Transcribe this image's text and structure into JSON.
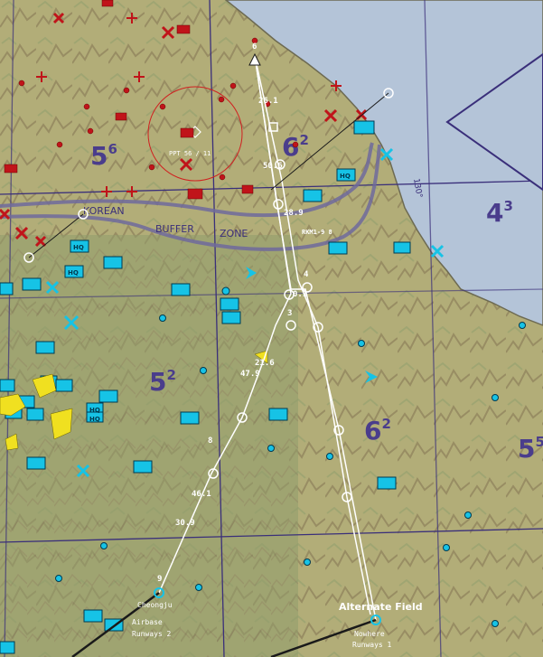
{
  "colors": {
    "sea": "#b4c4d8",
    "land_light": "#b6b07a",
    "land_green": "#8f9a68",
    "mountain": "#8f7f5c",
    "grid_line": "#3a2f7a",
    "sector_number": "#4a3d8c",
    "friendly": "#16c3e6",
    "hostile": "#c0141a",
    "route": "#ffffff",
    "dmz_band": "#6f6a9c",
    "yellow_unit": "#f0e020"
  },
  "sector_labels": [
    {
      "id": "5-6",
      "main": "5",
      "sup": "6"
    },
    {
      "id": "6-2-north",
      "main": "6",
      "sup": "2"
    },
    {
      "id": "4-3",
      "main": "4",
      "sup": "3"
    },
    {
      "id": "5-2",
      "main": "5",
      "sup": "2"
    },
    {
      "id": "6-2-south",
      "main": "6",
      "sup": "2"
    },
    {
      "id": "5-5",
      "main": "5",
      "sup": "5"
    }
  ],
  "dmz_labels": [
    "KOREAN",
    "BUFFER",
    "ZONE"
  ],
  "meridian_label": "130°",
  "ppt_label": "PPT 56 / 11",
  "route_labels": [
    {
      "id": "wp6",
      "text": "6"
    },
    {
      "id": "d26-1",
      "text": "26.1"
    },
    {
      "id": "d50-6",
      "text": "50.6"
    },
    {
      "id": "d28-9",
      "text": "28.9"
    },
    {
      "id": "rkm",
      "text": "RKM1-9 8"
    },
    {
      "id": "wp4",
      "text": "4"
    },
    {
      "id": "d0-1",
      "text": "0.1"
    },
    {
      "id": "wp3",
      "text": "3"
    },
    {
      "id": "d21-6",
      "text": "21.6"
    },
    {
      "id": "d47-9",
      "text": "47.9"
    },
    {
      "id": "wp8",
      "text": "8"
    },
    {
      "id": "d46-1",
      "text": "46.1"
    },
    {
      "id": "d30-9",
      "text": "30.9"
    },
    {
      "id": "wp9",
      "text": "9"
    }
  ],
  "airbases": [
    {
      "id": "cheongju",
      "line1": "Cheongju",
      "line2": "Airbase",
      "line3": "Runways 2"
    },
    {
      "id": "alternate",
      "title": "Alternate Field",
      "line2": "Nowhere",
      "line3": "Runways 1"
    }
  ],
  "hq_labels": [
    "HQ",
    "HQ",
    "HQ",
    "HQ",
    "HQ"
  ]
}
